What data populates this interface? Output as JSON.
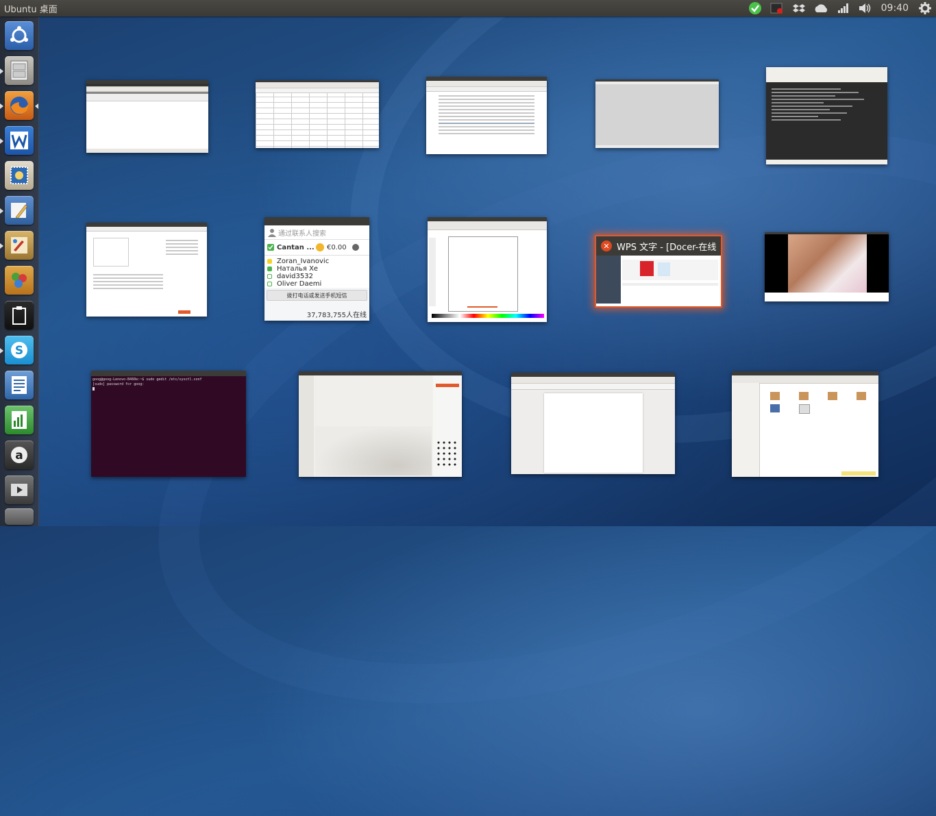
{
  "panel": {
    "title": "Ubuntu 桌面",
    "clock": "09:40"
  },
  "tray_icons": [
    "check-icon",
    "record-icon",
    "dropbox-icon",
    "cloud-icon",
    "network-signal-icon",
    "volume-icon",
    "gear-icon"
  ],
  "launcher": {
    "items": [
      "ubuntu-dash-icon",
      "file-cabinet-icon",
      "firefox-icon",
      "wps-writer-icon",
      "mail-stamp-icon",
      "text-editor-icon",
      "paint-icon",
      "puzzle-icon",
      "clipboard-icon",
      "skype-icon",
      "document-icon",
      "spreadsheet-icon",
      "amazon-icon",
      "video-player-icon",
      "workspace-icon"
    ]
  },
  "skype": {
    "search_placeholder": "通过联系人搜索",
    "account": "Cantan ...",
    "credit": "€0.00",
    "contacts": [
      "Zoran_Ivanovic",
      "Наталья Хе",
      "david3532",
      "Oliver Daemi"
    ],
    "call_button": "拨打电话或发送手机短信",
    "online_count": "37,783,755人在线"
  },
  "wps_window": {
    "title": "WPS 文字 - [Docer-在线"
  },
  "terminal": {
    "line1": "goog@goog-Lenovo-B460e:~$ sudo gedit /etc/sysctl.conf",
    "line2": "[sudo] password for goog:"
  },
  "colors": {
    "accent": "#e05a2b",
    "panel": "#3c3b37",
    "terminal_bg": "#300a24"
  }
}
